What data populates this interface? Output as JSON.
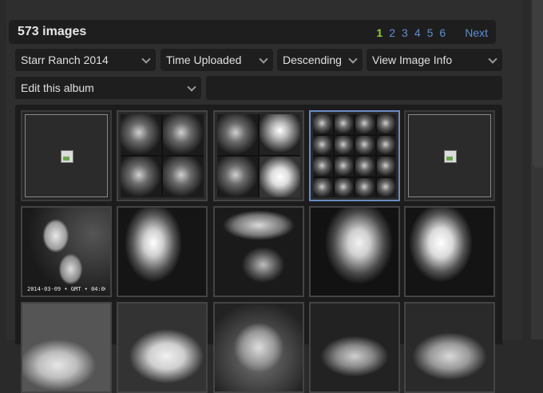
{
  "header": {
    "image_count": "573 images",
    "pages": [
      "1",
      "2",
      "3",
      "4",
      "5",
      "6"
    ],
    "current_page": "1",
    "next_label": "Next"
  },
  "controls": {
    "album_select": "Starr Ranch 2014",
    "sort_by_select": "Time Uploaded",
    "order_select": "Descending",
    "view_select": "View Image Info",
    "edit_select": "Edit this album"
  },
  "thumbnails": [
    {
      "kind": "broken",
      "caption": ""
    },
    {
      "kind": "mosaic4",
      "caption": ""
    },
    {
      "kind": "mosaic4",
      "caption": ""
    },
    {
      "kind": "mosaic16",
      "caption": "",
      "selected": true
    },
    {
      "kind": "broken",
      "caption": ""
    },
    {
      "kind": "owl",
      "caption": "2014-03-09 • GMT • 04:06"
    },
    {
      "kind": "glow",
      "caption": ""
    },
    {
      "kind": "nest",
      "caption": ""
    },
    {
      "kind": "glow",
      "caption": ""
    },
    {
      "kind": "glow",
      "caption": ""
    }
  ],
  "icons": {
    "dropdown": "chevron-down-icon",
    "broken_image": "broken-image-icon"
  }
}
